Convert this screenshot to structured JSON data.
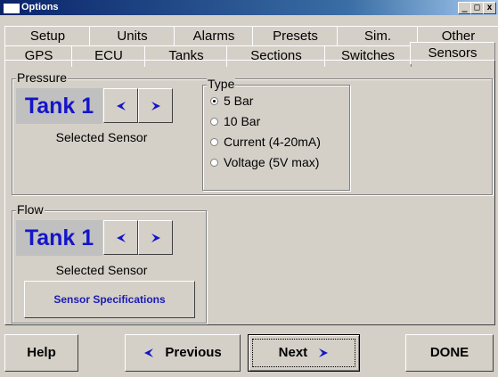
{
  "window": {
    "title": "Options",
    "controls": {
      "minimize": "_",
      "maximize": "□",
      "close": "x"
    }
  },
  "tabs": {
    "row1": [
      "Setup",
      "Units",
      "Alarms",
      "Presets",
      "Sim.",
      "Other"
    ],
    "row2": [
      "GPS",
      "ECU",
      "Tanks",
      "Sections",
      "Switches",
      "Sensors"
    ],
    "active": "Sensors"
  },
  "pressure": {
    "legend": "Pressure",
    "tank": "Tank 1",
    "caption": "Selected Sensor",
    "prev_icon": "left-arrow-icon",
    "next_icon": "right-arrow-icon",
    "type": {
      "legend": "Type",
      "options": [
        "5 Bar",
        "10 Bar",
        "Current (4-20mA)",
        "Voltage (5V max)"
      ],
      "selected": "5 Bar"
    }
  },
  "flow": {
    "legend": "Flow",
    "tank": "Tank 1",
    "caption": "Selected Sensor",
    "spec_button": "Sensor Specifications"
  },
  "footer": {
    "help": "Help",
    "previous": "Previous",
    "next": "Next",
    "done": "DONE"
  },
  "colors": {
    "accent_blue": "#1515c8",
    "face": "#d4d0c8",
    "tank_label_bg": "#c0c0c0",
    "title_bar": "#0a246a"
  }
}
